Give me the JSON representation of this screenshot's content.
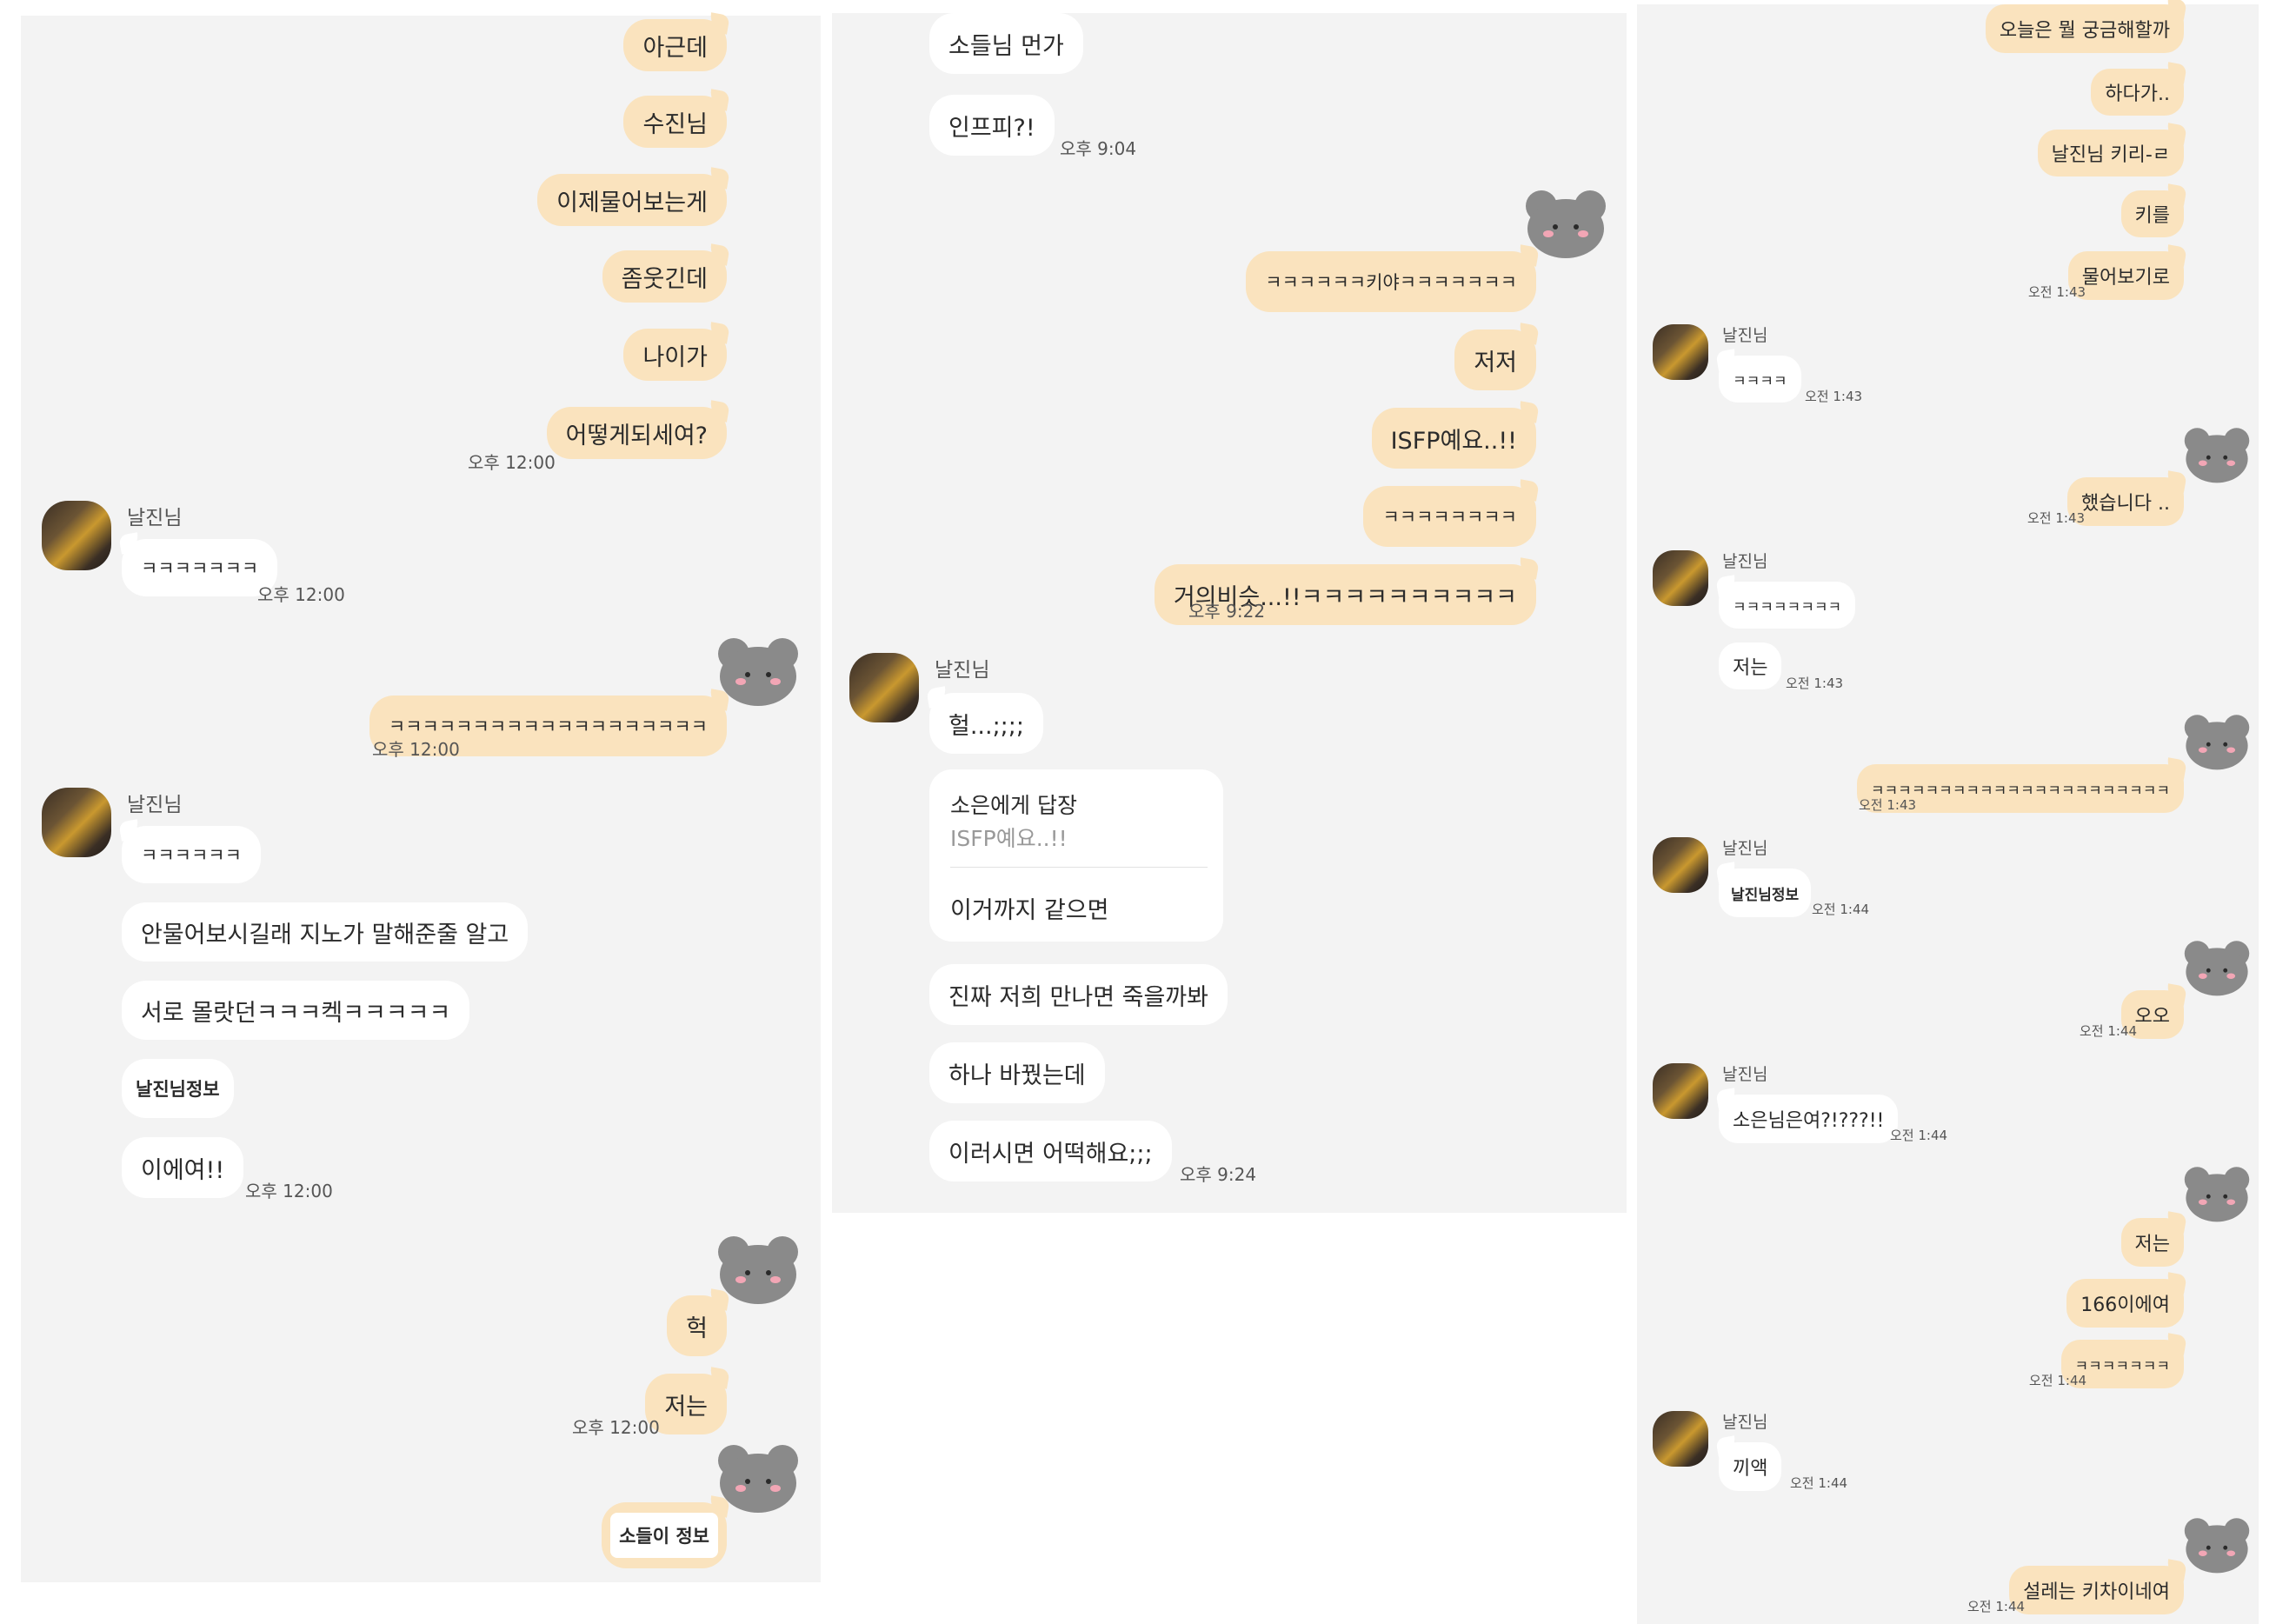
{
  "colors": {
    "panel_bg": "#f3f3f3",
    "my_bubble": "#fae3be",
    "other_bubble": "#ffffff",
    "time_text": "#555555"
  },
  "icons": {
    "my_avatar": "gray-bear-sticker-icon",
    "other_avatar": "user-photo-avatar"
  },
  "panel1": {
    "msg1": "아근데",
    "msg2": "수진님",
    "msg3": "이제물어보는게",
    "msg4": "좀웃긴데",
    "msg5": "나이가",
    "msg6": "어떻게되세여?",
    "time1": "오후 12:00",
    "sender1": "날진님",
    "reply1": "ㅋㅋㅋㅋㅋㅋㅋ",
    "time2": "오후 12:00",
    "msg7": "ㅋㅋㅋㅋㅋㅋㅋㅋㅋㅋㅋㅋㅋㅋㅋㅋㅋㅋㅋ",
    "time3": "오후 12:00",
    "sender2": "날진님",
    "reply2": "ㅋㅋㅋㅋㅋㅋ",
    "reply3": "안물어보시길래 지노가 말해준줄 알고",
    "reply4": "서로 몰랏던ㅋㅋㅋ켁ㅋㅋㅋㅋㅋ",
    "reply5": "날진님정보",
    "reply6": "이에여!!",
    "time4": "오후 12:00",
    "msg8": "헉",
    "msg9": "저는",
    "time5": "오후 12:00",
    "msg10": "소들이 정보"
  },
  "panel2": {
    "msg1": "소들님 먼가",
    "msg2": "인프피?!",
    "time1": "오후 9:04",
    "reply1": "ㅋㅋㅋㅋㅋㅋ키야ㅋㅋㅋㅋㅋㅋㅋ",
    "reply2": "저저",
    "reply3": "ISFP예요..!!",
    "reply4": "ㅋㅋㅋㅋㅋㅋㅋㅋ",
    "reply5": "거의비슷...!!ㅋㅋㅋㅋㅋㅋㅋㅋㅋㅋ",
    "time2": "오후 9:22",
    "sender": "날진님",
    "msg3": "헐...;;;;",
    "reply_to": "소은에게 답장",
    "reply_quote": "ISFP예요..!!",
    "reply_text": "이거까지 같으면",
    "msg4": "진짜 저희 만나면 죽을까봐",
    "msg5": "하나 바꿨는데",
    "msg6": "이러시면 어떡해요;;;",
    "time3": "오후 9:24"
  },
  "panel3": {
    "msg1": "오늘은 뭘 궁금해할까",
    "msg2": "하다가..",
    "msg3": "날진님 키리-ㄹ",
    "msg4": "키를",
    "msg5": "물어보기로",
    "time1": "오전 1:43",
    "sender1": "날진님",
    "reply1": "ㅋㅋㅋㅋ",
    "time2": "오전 1:43",
    "msg6": "했습니다 ..",
    "time3": "오전 1:43",
    "sender2": "날진님",
    "reply2": "ㅋㅋㅋㅋㅋㅋㅋㅋ",
    "reply3": "저는",
    "time4": "오전 1:43",
    "msg7": "ㅋㅋㅋㅋㅋㅋㅋㅋㅋㅋㅋㅋㅋㅋㅋㅋㅋㅋㅋㅋㅋㅋ",
    "time5": "오전 1:43",
    "sender3": "날진님",
    "reply4": "날진님정보",
    "time6": "오전 1:44",
    "msg8": "오오",
    "time7": "오전 1:44",
    "sender4": "날진님",
    "reply5": "소은님은여?!???!!",
    "time8": "오전 1:44",
    "msg9": "저는",
    "msg10": "166이에여",
    "msg11": "ㅋㅋㅋㅋㅋㅋㅋ",
    "time9": "오전 1:44",
    "sender5": "날진님",
    "reply6": "끼액",
    "time10": "오전 1:44",
    "msg12": "설레는 키차이네여",
    "time11": "오전 1:44"
  }
}
